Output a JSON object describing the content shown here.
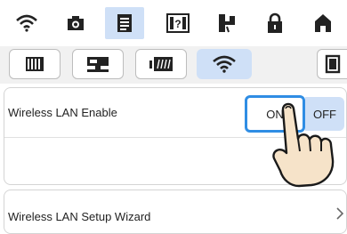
{
  "topbar": {
    "icons": [
      "wifi-icon",
      "camera-icon",
      "document-icon",
      "help-icon",
      "needle-icon",
      "lock-icon",
      "home-icon"
    ],
    "active_index": 2
  },
  "tabs": {
    "icons": [
      "book-icon",
      "sewing-machine-icon",
      "embroidery-icon",
      "wifi-icon",
      "frame-icon"
    ],
    "active_index": 3
  },
  "settings": {
    "wireless_lan_enable": "Wireless LAN Enable",
    "on_label": "ON",
    "off_label": "OFF"
  },
  "wizard": {
    "label": "Wireless LAN Setup Wizard"
  },
  "colors": {
    "active_bg": "#cfe0f7",
    "accent": "#2f8de4"
  }
}
